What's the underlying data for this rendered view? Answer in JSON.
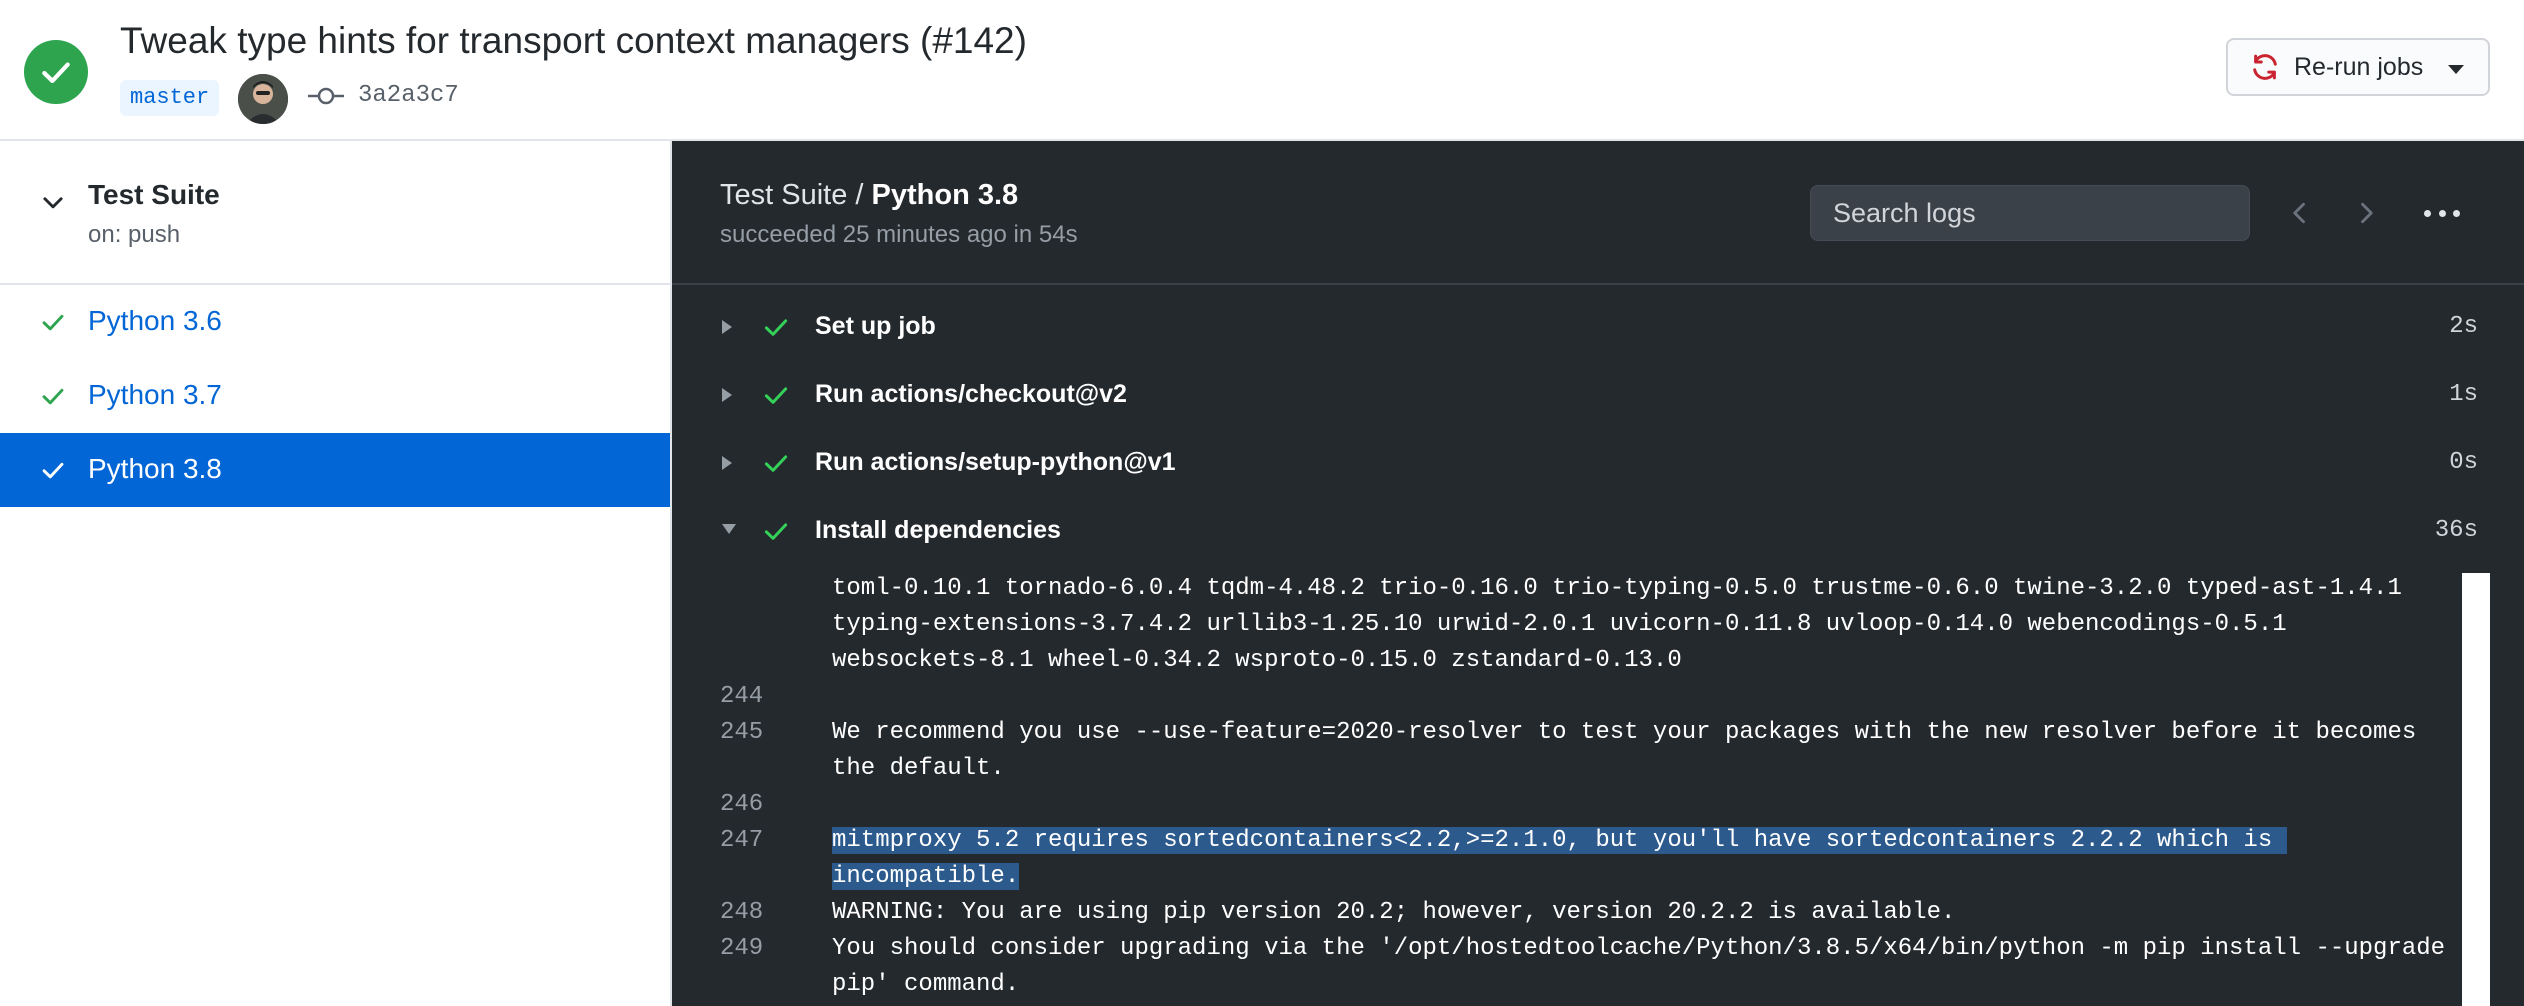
{
  "header": {
    "title": "Tweak type hints for transport context managers (#142)",
    "branch": "master",
    "commit": "3a2a3c7",
    "rerun_label": "Re-run jobs"
  },
  "sidebar": {
    "workflow_name": "Test Suite",
    "workflow_trigger": "on: push",
    "jobs": [
      {
        "label": "Python 3.6",
        "status": "success"
      },
      {
        "label": "Python 3.7",
        "status": "success"
      },
      {
        "label": "Python 3.8",
        "status": "success",
        "selected": true
      }
    ]
  },
  "log": {
    "crumb_workflow": "Test Suite /",
    "crumb_job": "Python 3.8",
    "status": "succeeded 25 minutes ago in 54s",
    "search_placeholder": "Search logs",
    "steps": [
      {
        "name": "Set up job",
        "duration": "2s",
        "expanded": false
      },
      {
        "name": "Run actions/checkout@v2",
        "duration": "1s",
        "expanded": false
      },
      {
        "name": "Run actions/setup-python@v1",
        "duration": "0s",
        "expanded": false
      },
      {
        "name": "Install dependencies",
        "duration": "36s",
        "expanded": true
      }
    ],
    "lines": [
      {
        "num": "",
        "text": "toml-0.10.1 tornado-6.0.4 tqdm-4.48.2 trio-0.16.0 trio-typing-0.5.0 trustme-0.6.0 twine-3.2.0 typed-ast-1.4.1"
      },
      {
        "num": "",
        "text": "typing-extensions-3.7.4.2 urllib3-1.25.10 urwid-2.0.1 uvicorn-0.11.8 uvloop-0.14.0 webencodings-0.5.1"
      },
      {
        "num": "",
        "text": "websockets-8.1 wheel-0.34.2 wsproto-0.15.0 zstandard-0.13.0"
      },
      {
        "num": "244",
        "text": ""
      },
      {
        "num": "245",
        "text": "We recommend you use --use-feature=2020-resolver to test your packages with the new resolver before it becomes"
      },
      {
        "num": "",
        "text": "the default."
      },
      {
        "num": "246",
        "text": ""
      },
      {
        "num": "247",
        "text": "mitmproxy 5.2 requires sortedcontainers<2.2,>=2.1.0, but you'll have sortedcontainers 2.2.2 which is "
      },
      {
        "num": "",
        "text": "incompatible."
      },
      {
        "num": "248",
        "text": "WARNING: You are using pip version 20.2; however, version 20.2.2 is available."
      },
      {
        "num": "249",
        "text": "You should consider upgrading via the '/opt/hostedtoolcache/Python/3.8.5/x64/bin/python -m pip install --upgrade"
      },
      {
        "num": "",
        "text": "pip' command."
      }
    ]
  },
  "colors": {
    "success": "#2ea44f",
    "link": "#0366d6",
    "log_bg": "#24292e",
    "highlight": "#2c5a8c"
  }
}
